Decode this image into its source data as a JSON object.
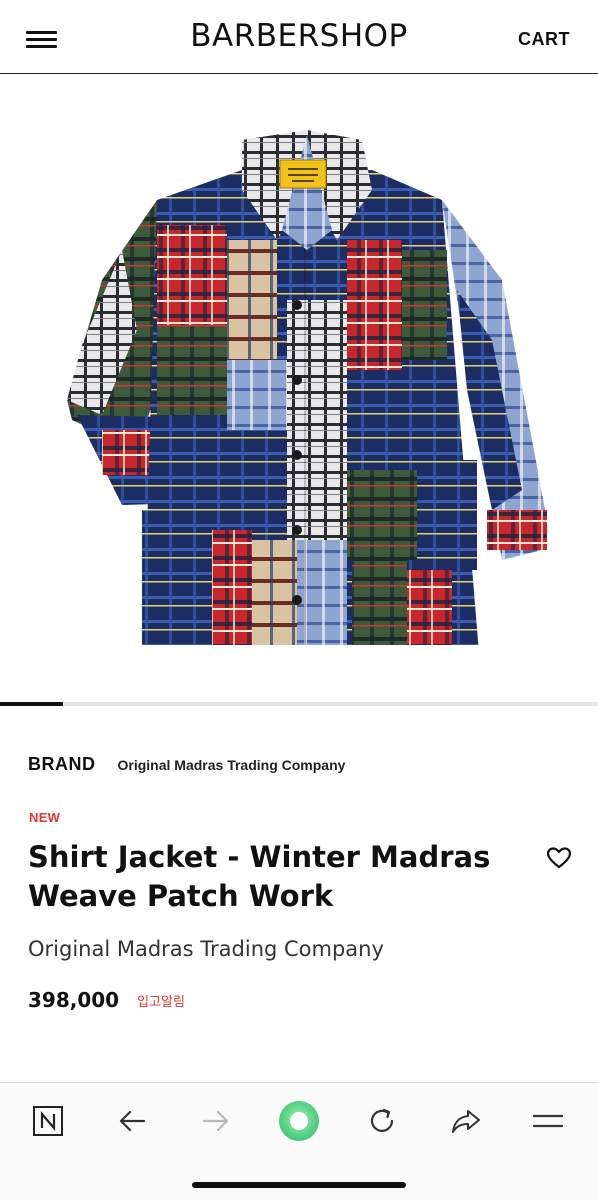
{
  "header": {
    "logo": "BARBERSHOP",
    "cart_label": "CART"
  },
  "gallery": {
    "image_alt": "Patchwork madras plaid shirt jacket",
    "progress_fraction": 0.105
  },
  "product": {
    "brand_label": "BRAND",
    "brand_name": "Original Madras Trading Company",
    "badge": "NEW",
    "title": "Shirt Jacket - Winter Madras Weave Patch Work",
    "subtitle": "Original Madras Trading Company",
    "price": "398,000",
    "restock_label": "입고알림",
    "wishlist_icon": "heart-outline-icon"
  },
  "browser_bar": {
    "items": [
      {
        "name": "naver-home",
        "icon": "naver-n-icon"
      },
      {
        "name": "back",
        "icon": "arrow-left-icon"
      },
      {
        "name": "forward",
        "icon": "arrow-right-icon"
      },
      {
        "name": "green-dot",
        "icon": "green-circle-icon"
      },
      {
        "name": "refresh",
        "icon": "refresh-icon"
      },
      {
        "name": "share",
        "icon": "share-icon"
      },
      {
        "name": "more",
        "icon": "menu-icon"
      }
    ],
    "accent_color": "#5fd98a",
    "disabled_color": "#b9b9b9"
  },
  "colors": {
    "accent_red": "#e0362c",
    "text": "#111111"
  }
}
